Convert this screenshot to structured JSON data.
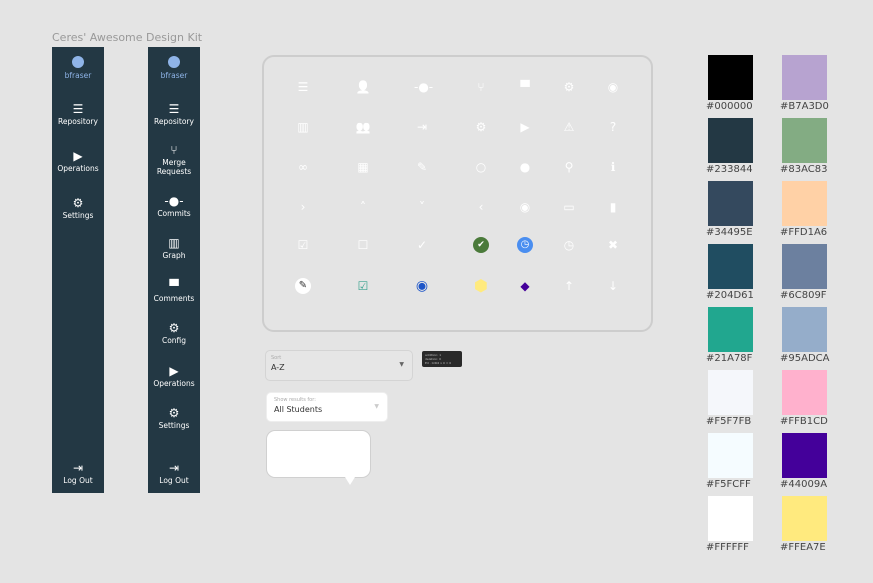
{
  "title": "Ceres' Awesome Design Kit",
  "sidebar_a": {
    "user": "bfraser",
    "items": [
      {
        "label": "Repository",
        "icon": "list-icon"
      },
      {
        "label": "Operations",
        "icon": "play-icon"
      },
      {
        "label": "Settings",
        "icon": "gear-icon"
      }
    ],
    "logout": "Log Out"
  },
  "sidebar_b": {
    "user": "bfraser",
    "items": [
      {
        "label": "Repository"
      },
      {
        "label": "Merge Requests"
      },
      {
        "label": "Commits"
      },
      {
        "label": "Graph"
      },
      {
        "label": "Comments"
      },
      {
        "label": "Config"
      },
      {
        "label": "Operations"
      },
      {
        "label": "Settings"
      }
    ],
    "logout": "Log Out"
  },
  "sort": {
    "label": "Sort",
    "value": "A-Z"
  },
  "filter": {
    "label": "Show results for:",
    "value": "All Students"
  },
  "tooltip": {
    "lines": [
      "addition: 1",
      "deletion: 0",
      "Ed · 0d02 x 0 = 0"
    ]
  },
  "swatches": [
    {
      "hex": "#000000"
    },
    {
      "hex": "#B7A3D0"
    },
    {
      "hex": "#233844"
    },
    {
      "hex": "#83AC83"
    },
    {
      "hex": "#34495E"
    },
    {
      "hex": "#FFD1A6"
    },
    {
      "hex": "#204D61"
    },
    {
      "hex": "#6C809F"
    },
    {
      "hex": "#21A78F"
    },
    {
      "hex": "#95ADCA"
    },
    {
      "hex": "#F5F7FB"
    },
    {
      "hex": "#FFB1CD"
    },
    {
      "hex": "#F5FCFF"
    },
    {
      "hex": "#44009A"
    },
    {
      "hex": "#FFFFFF"
    },
    {
      "hex": "#FFEA7E"
    }
  ]
}
